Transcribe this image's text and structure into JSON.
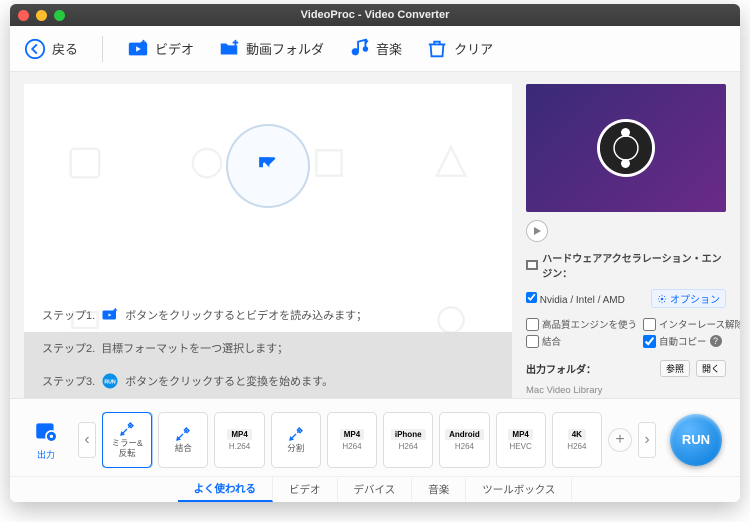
{
  "window": {
    "title": "VideoProc - Video Converter"
  },
  "toolbar": {
    "back": "戻る",
    "video": "ビデオ",
    "folder": "動画フォルダ",
    "music": "音楽",
    "clear": "クリア"
  },
  "steps": {
    "s1_prefix": "ステップ1.",
    "s1_suffix": "ボタンをクリックするとビデオを読み込みます；",
    "s2_prefix": "ステップ2.",
    "s2_text": "目標フォーマットを一つ選択します；",
    "s3_prefix": "ステップ3.",
    "s3_suffix": "ボタンをクリックすると変換を始めます。"
  },
  "hw": {
    "title": "ハードウェアアクセラレーション・エンジン：",
    "gpu_label": "Nvidia / Intel / AMD",
    "options": "オプション",
    "hq_engine": "高品質エンジンを使う",
    "deinterlace": "インターレース解除",
    "join": "結合",
    "autocopy": "自動コピー"
  },
  "output": {
    "label": "出力フォルダ：",
    "browse": "参照",
    "open": "開く",
    "path": "Mac Video Library"
  },
  "out_icon": "出力",
  "formats": [
    {
      "top": "ミラー&\n反転",
      "badge": "",
      "sub": "",
      "icon": "tool",
      "selected": true
    },
    {
      "top": "結合",
      "badge": "",
      "sub": "",
      "icon": "tool"
    },
    {
      "top": "",
      "badge": "MP4",
      "sub": "H.264",
      "icon": ""
    },
    {
      "top": "分割",
      "badge": "",
      "sub": "",
      "icon": "tool"
    },
    {
      "top": "",
      "badge": "MP4",
      "sub": "H264",
      "icon": ""
    },
    {
      "top": "",
      "badge": "iPhone",
      "sub": "H264",
      "icon": ""
    },
    {
      "top": "",
      "badge": "Android",
      "sub": "H264",
      "icon": ""
    },
    {
      "top": "",
      "badge": "MP4",
      "sub": "HEVC",
      "icon": ""
    },
    {
      "top": "",
      "badge": "4K",
      "sub": "H264",
      "icon": ""
    }
  ],
  "run": "RUN",
  "tabs": [
    "よく使われる",
    "ビデオ",
    "デバイス",
    "音楽",
    "ツールボックス"
  ],
  "active_tab": 0
}
